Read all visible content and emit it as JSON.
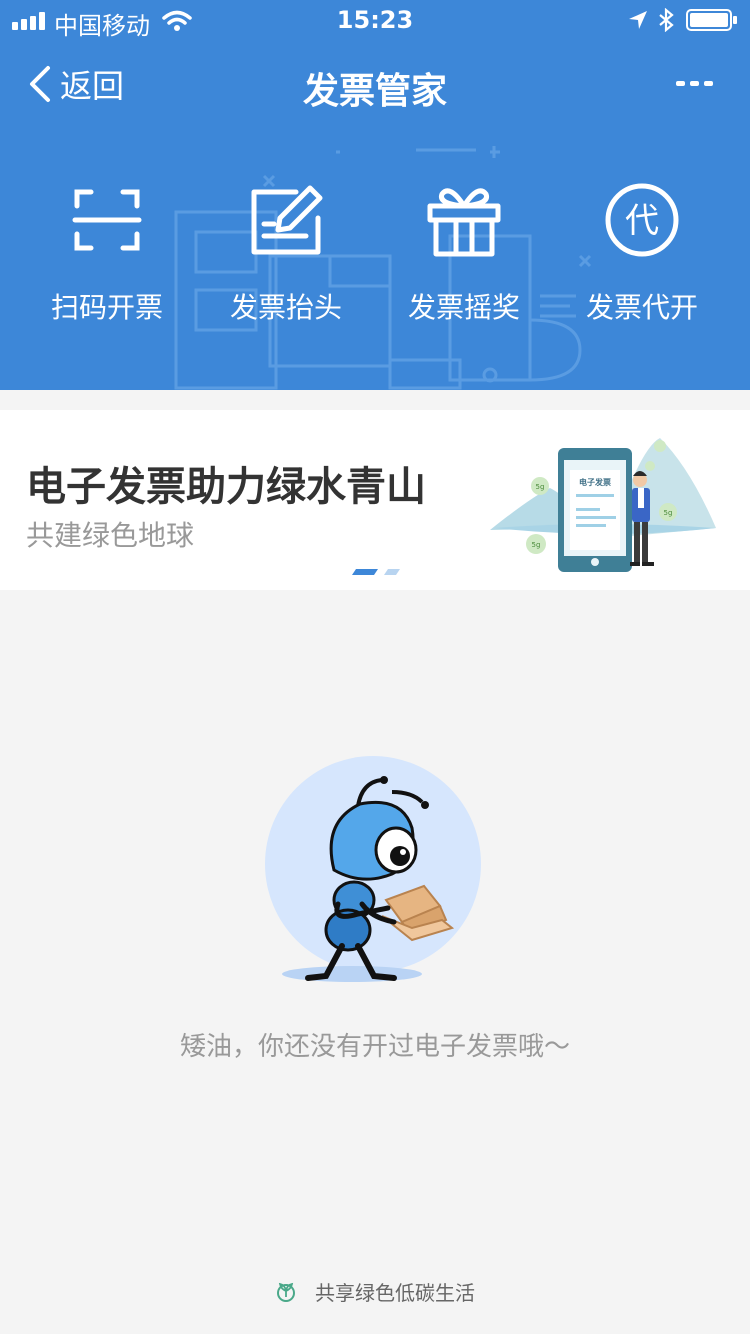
{
  "status_bar": {
    "carrier": "中国移动",
    "time": "15:23"
  },
  "nav": {
    "back_label": "返回",
    "title": "发票管家",
    "more_icon": "ellipsis-icon"
  },
  "actions": [
    {
      "label": "扫码开票",
      "icon": "scan-icon"
    },
    {
      "label": "发票抬头",
      "icon": "edit-icon"
    },
    {
      "label": "发票摇奖",
      "icon": "gift-icon"
    },
    {
      "label": "发票代开",
      "icon": "proxy-icon",
      "icon_char": "代"
    }
  ],
  "banner": {
    "title": "电子发票助力绿水青山",
    "subtitle": "共建绿色地球",
    "phone_label": "电子发票",
    "bubble_label": "5g",
    "page_count": 2,
    "active_page": 1
  },
  "empty_state": {
    "message": "矮油，你还没有开过电子发票哦～"
  },
  "footer": {
    "text": "共享绿色低碳生活",
    "icon": "sprout-icon"
  },
  "colors": {
    "header_bg": "#3d87d8",
    "page_bg": "#f4f4f4",
    "footer_icon": "#4aa889"
  }
}
